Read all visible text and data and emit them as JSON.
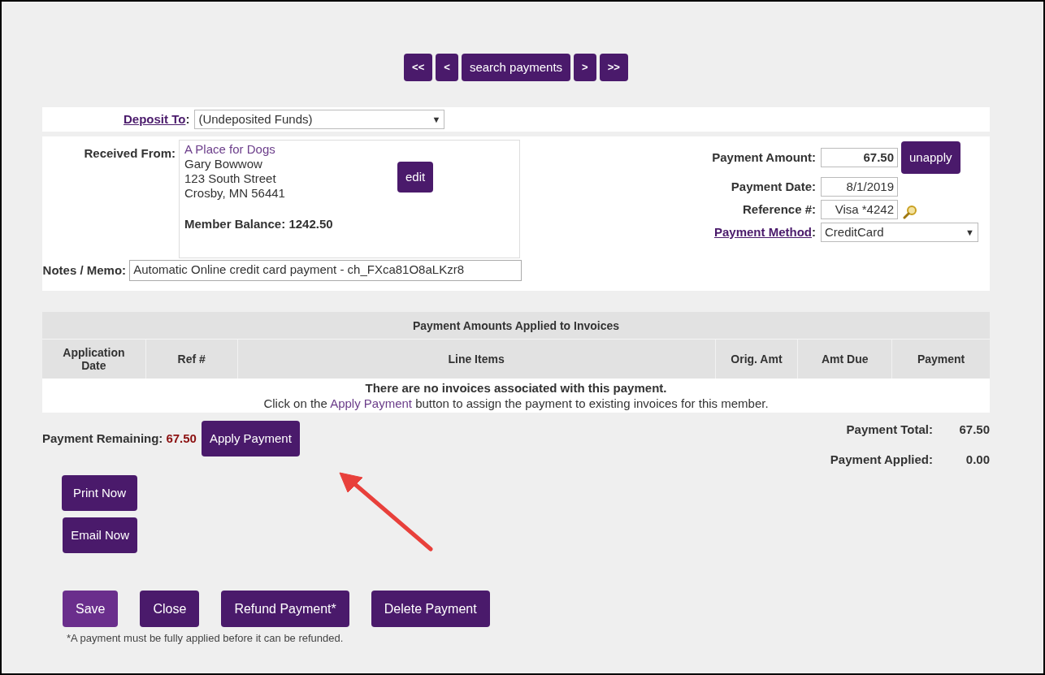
{
  "nav_buttons": [
    "<<",
    "<",
    "search payments",
    ">",
    ">>"
  ],
  "deposit": {
    "label": "Deposit To",
    "colon": ":",
    "value": "(Undeposited Funds)",
    "caret": "▼"
  },
  "received_from": {
    "label": "Received From:",
    "member_link": "A Place for Dogs",
    "address_lines": [
      "Gary Bowwow",
      "123 South Street",
      "Crosby, MN 56441"
    ],
    "balance": "Member Balance: 1242.50",
    "edit_button": "edit"
  },
  "payment": {
    "amount_label": "Payment Amount:",
    "amount": "67.50",
    "unapply_button": "unapply",
    "date_label": "Payment Date:",
    "date": "8/1/2019",
    "reference_label": "Reference #:",
    "reference": "Visa *4242",
    "method_label": "Payment Method",
    "method_colon": ":",
    "method": "CreditCard",
    "method_caret": "▼"
  },
  "notes": {
    "label": "Notes / Memo:",
    "value": "Automatic Online credit card payment - ch_FXca81O8aLKzr8"
  },
  "table": {
    "title": "Payment Amounts Applied to Invoices",
    "columns": [
      "Application Date",
      "Ref #",
      "Line Items",
      "Orig. Amt",
      "Amt Due",
      "Payment"
    ],
    "empty_message": "There are no invoices associated with this payment.",
    "hint_before": "Click on the ",
    "hint_link": "Apply Payment",
    "hint_after": " button to assign the payment to existing invoices for this member."
  },
  "remaining": {
    "label": "Payment Remaining:",
    "value": "67.50",
    "apply_button": "Apply Payment"
  },
  "totals": [
    {
      "label": "Payment Total:",
      "value": "67.50"
    },
    {
      "label": "Payment Applied:",
      "value": "0.00"
    }
  ],
  "side_buttons": [
    "Print Now",
    "Email Now"
  ],
  "actions": [
    {
      "label": "Save",
      "highlighted": true
    },
    {
      "label": "Close",
      "highlighted": false
    },
    {
      "label": "Refund Payment*",
      "highlighted": false
    },
    {
      "label": "Delete Payment",
      "highlighted": false
    }
  ],
  "footnote": "*A payment must be fully applied before it can be refunded."
}
